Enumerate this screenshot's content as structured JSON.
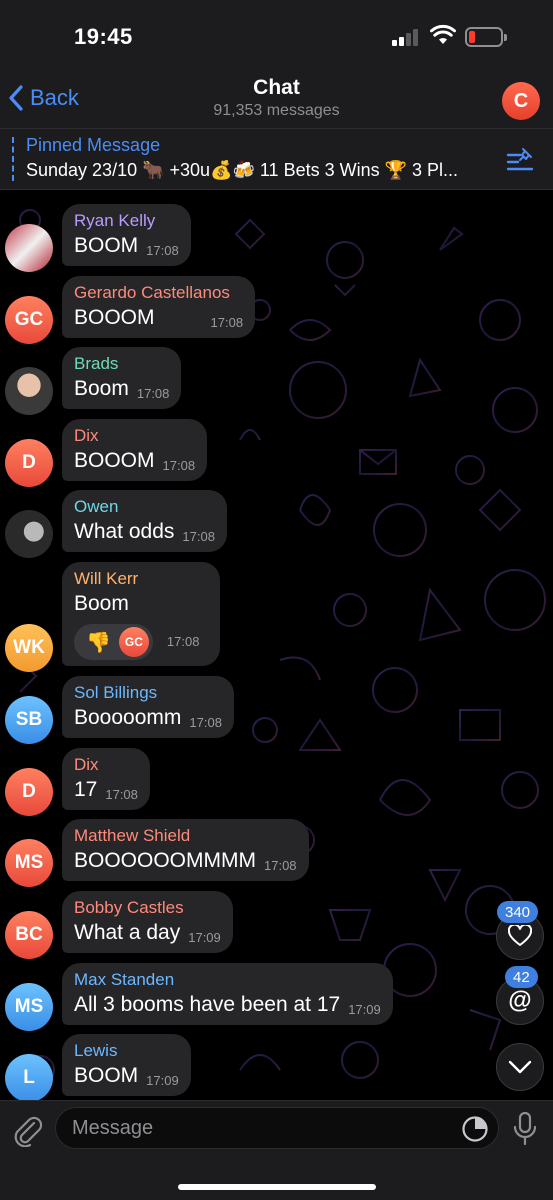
{
  "status": {
    "time": "19:45"
  },
  "nav": {
    "back_label": "Back",
    "title": "Chat",
    "subtitle": "91,353 messages",
    "avatar_letter": "C"
  },
  "pinned": {
    "title": "Pinned Message",
    "text": "Sunday 23/10 🐂 +30u💰🍻 11 Bets 3 Wins 🏆 3 Pl..."
  },
  "messages": [
    {
      "sender": "Ryan Kelly",
      "text": "BOOM",
      "time": "17:08",
      "sender_color": "#b99cff"
    },
    {
      "sender": "Gerardo Castellanos",
      "text": "BOOOM",
      "time": "17:08",
      "sender_color": "#ff8a7a",
      "avatar": "GC"
    },
    {
      "sender": "Brads",
      "text": "Boom",
      "time": "17:08",
      "sender_color": "#6fdcb4"
    },
    {
      "sender": "Dix",
      "text": "BOOOM",
      "time": "17:08",
      "sender_color": "#ff8a7a",
      "avatar": "D"
    },
    {
      "sender": "Owen",
      "text": "What odds",
      "time": "17:08",
      "sender_color": "#6fd6e8"
    },
    {
      "sender": "Will Kerr",
      "text": "Boom",
      "time": "17:08",
      "sender_color": "#ffb36b",
      "avatar": "WK",
      "reaction": {
        "emoji": "👎",
        "avatar": "GC"
      }
    },
    {
      "sender": "Sol Billings",
      "text": "Booooomm",
      "time": "17:08",
      "sender_color": "#6cb8ff",
      "avatar": "SB"
    },
    {
      "sender": "Dix",
      "text": "17",
      "time": "17:08",
      "sender_color": "#ff8a7a",
      "avatar": "D"
    },
    {
      "sender": "Matthew Shield",
      "text": "BOOOOOOMMMM",
      "time": "17:08",
      "sender_color": "#ff8a7a",
      "avatar": "MS"
    },
    {
      "sender": "Bobby Castles",
      "text": "What a day",
      "time": "17:09",
      "sender_color": "#ff8a7a",
      "avatar": "BC"
    },
    {
      "sender": "Max Standen",
      "text": "All 3 booms have been at 17",
      "time": "17:09",
      "sender_color": "#6cb8ff",
      "avatar": "MS"
    },
    {
      "sender": "Lewis",
      "text": "BOOM",
      "time": "17:09",
      "sender_color": "#6cb8ff",
      "avatar": "L"
    }
  ],
  "side": {
    "reactions_count": "340",
    "mentions_count": "42"
  },
  "composer": {
    "placeholder": "Message"
  },
  "colors": {
    "accent": "#4a8df8",
    "bubble": "#262628",
    "bar": "#1c1c1e"
  }
}
